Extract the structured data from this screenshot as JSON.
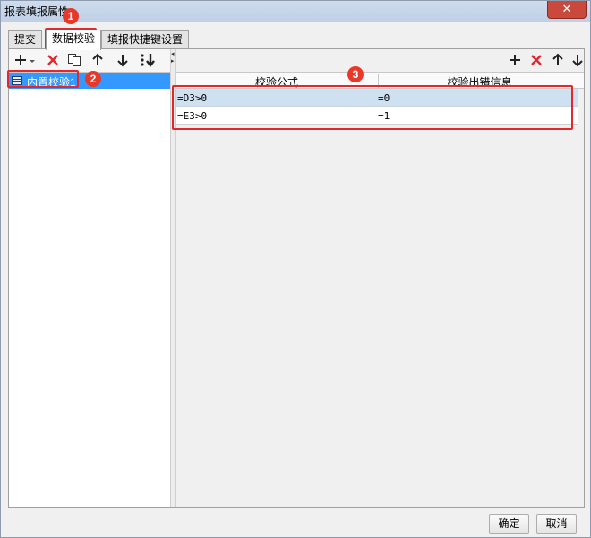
{
  "window": {
    "title": "报表填报属性",
    "close_symbol": "✕"
  },
  "tabs": [
    {
      "label": "提交"
    },
    {
      "label": "数据校验"
    },
    {
      "label": "填报快捷键设置"
    }
  ],
  "left_panel": {
    "toolbar_icons": [
      "add-dropdown-icon",
      "delete-icon",
      "copy-icon",
      "move-up-icon",
      "move-down-icon",
      "sort-icon"
    ],
    "items": [
      {
        "label": "内置校验1",
        "selected": true
      }
    ]
  },
  "right_panel": {
    "toolbar_icons": [
      "add-icon",
      "delete-icon",
      "move-up-icon",
      "move-down-icon"
    ],
    "columns": [
      "校验公式",
      "校验出错信息"
    ],
    "rows": [
      {
        "formula": "=D3>0",
        "message": "=0",
        "selected": true
      },
      {
        "formula": "=E3>0",
        "message": "=1",
        "selected": false
      }
    ]
  },
  "annotations": [
    "1",
    "2",
    "3"
  ],
  "footer": {
    "ok_label": "确定",
    "cancel_label": "取消"
  },
  "colors": {
    "accent_red": "#e0282e",
    "selection_blue": "#3399ff"
  }
}
